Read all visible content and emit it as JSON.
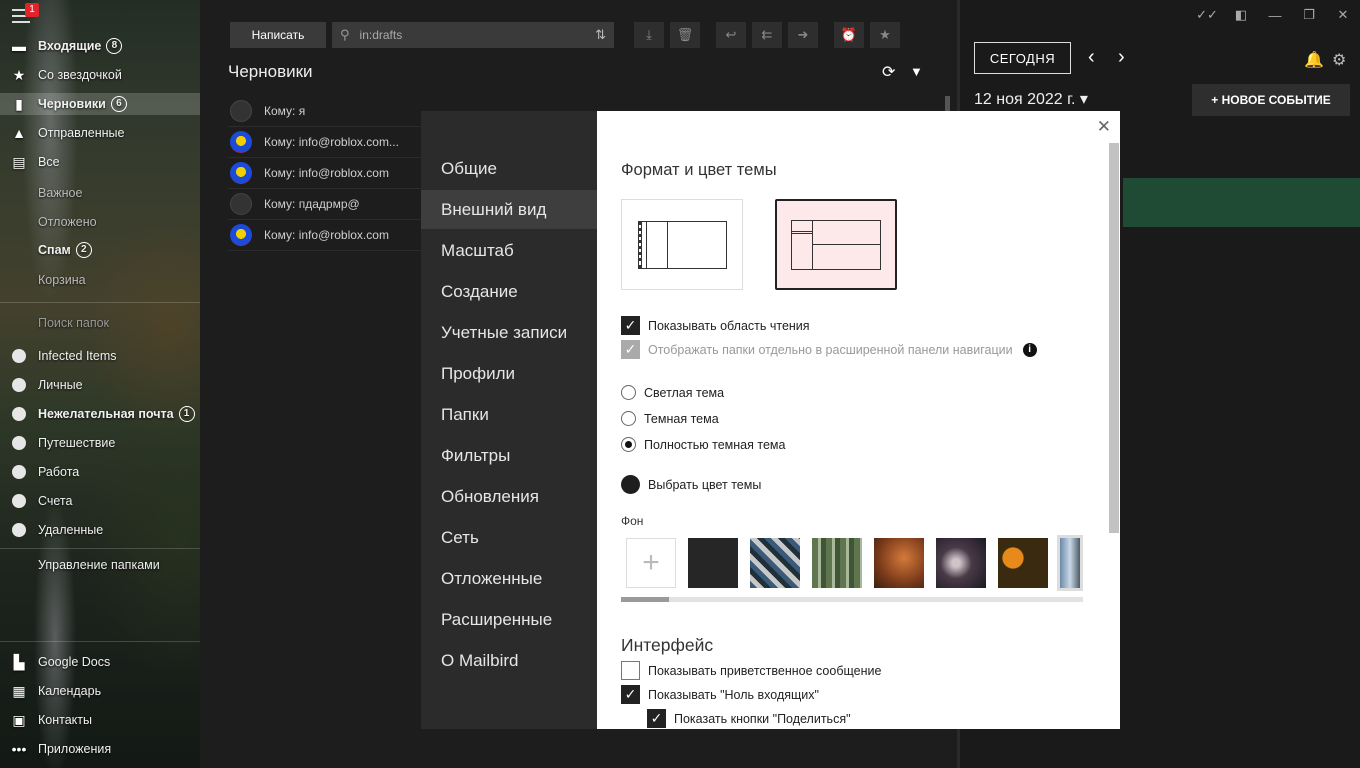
{
  "sidebar": {
    "menu_badge": "1",
    "items": [
      {
        "icon": "inbox-icon",
        "glyph": "▬",
        "label": "Входящие",
        "badge": "8",
        "bold": true
      },
      {
        "icon": "star-icon",
        "glyph": "★",
        "label": "Со звездочкой",
        "badge": "",
        "bold": false
      },
      {
        "icon": "drafts-icon",
        "glyph": "▮",
        "label": "Черновики",
        "badge": "6",
        "bold": true
      },
      {
        "icon": "sent-icon",
        "glyph": "▲",
        "label": "Отправленные",
        "badge": "",
        "bold": false
      },
      {
        "icon": "all-mail-icon",
        "glyph": "▤",
        "label": "Все",
        "badge": "",
        "bold": false
      }
    ],
    "subitems": [
      "Важное",
      "Отложено"
    ],
    "spam": {
      "label": "Спам",
      "badge": "2"
    },
    "trash": "Корзина",
    "folder_search": "Поиск папок",
    "folders": [
      {
        "label": "Infected Items",
        "badge": "",
        "bold": false
      },
      {
        "label": "Личные",
        "badge": "",
        "bold": false
      },
      {
        "label": "Нежелательная почта",
        "badge": "1",
        "bold": true
      },
      {
        "label": "Путешествие",
        "badge": "",
        "bold": false
      },
      {
        "label": "Работа",
        "badge": "",
        "bold": false
      },
      {
        "label": "Счета",
        "badge": "",
        "bold": false
      },
      {
        "label": "Удаленные",
        "badge": "",
        "bold": false
      }
    ],
    "manage_folders": "Управление папками",
    "apps": [
      {
        "icon": "google-docs-icon",
        "glyph": "▙",
        "label": "Google Docs"
      },
      {
        "icon": "calendar-icon",
        "glyph": "▦",
        "label": "Календарь"
      },
      {
        "icon": "contacts-icon",
        "glyph": "▣",
        "label": "Контакты"
      },
      {
        "icon": "apps-icon",
        "glyph": "•••",
        "label": "Приложения"
      }
    ]
  },
  "mail": {
    "compose_label": "Написать",
    "search_value": "in:drafts",
    "title": "Черновики",
    "rows": [
      {
        "avatar": "grey",
        "to": "Кому: я"
      },
      {
        "avatar": "ball",
        "to": "Кому: info@roblox.com..."
      },
      {
        "avatar": "ball",
        "to": "Кому: info@roblox.com"
      },
      {
        "avatar": "grey",
        "to": "Кому: пдадрмр@"
      },
      {
        "avatar": "ball",
        "to": "Кому: info@roblox.com"
      }
    ]
  },
  "calendar": {
    "today_label": "СЕГОДНЯ",
    "date_label": "12 ноя 2022 г. ▾",
    "new_event_label": "+ НОВОЕ СОБЫТИЕ"
  },
  "settings": {
    "nav": [
      "Общие",
      "Внешний вид",
      "Масштаб",
      "Создание",
      "Учетные записи",
      "Профили",
      "Папки",
      "Фильтры",
      "Обновления",
      "Сеть",
      "Отложенные",
      "Расширенные",
      "О Mailbird"
    ],
    "active_nav_index": 1,
    "section_theme_title": "Формат и цвет темы",
    "show_reading_pane": "Показывать область чтения",
    "separate_folders": "Отображать папки отдельно в расширенной панели навигации",
    "theme_options": [
      {
        "label": "Светлая тема",
        "selected": false
      },
      {
        "label": "Темная тема",
        "selected": false
      },
      {
        "label": "Полностью темная тема",
        "selected": true
      }
    ],
    "choose_color": "Выбрать цвет темы",
    "background_label": "Фон",
    "background_add": "+",
    "section_interface_title": "Интерфейс",
    "show_welcome": "Показывать приветственное сообщение",
    "show_inbox_zero": "Показывать \"Ноль входящих\"",
    "show_share_buttons": "Показать кнопки \"Поделиться\"",
    "accent_color": "#222222"
  }
}
